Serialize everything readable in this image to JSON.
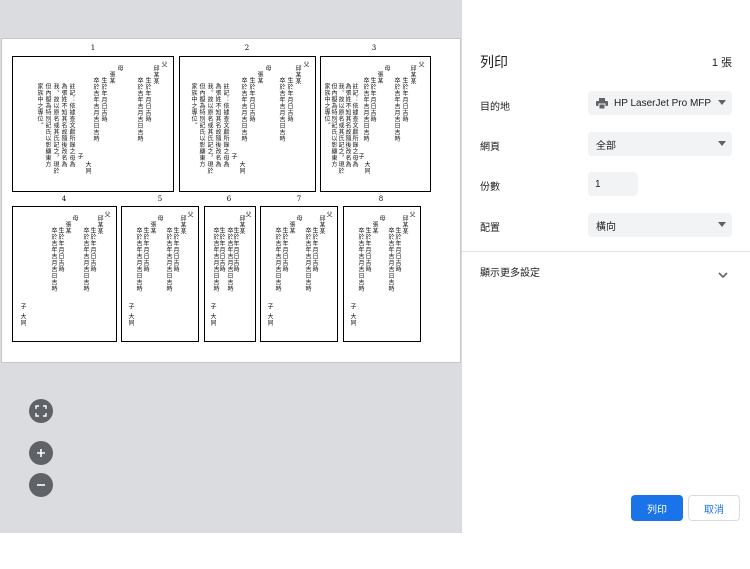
{
  "preview": {
    "page_numbers": [
      "1",
      "2",
      "3",
      "4",
      "5",
      "6",
      "7",
      "8"
    ],
    "pages_full": {
      "father": "父",
      "father_name": "邱某某",
      "mother": "母",
      "mother_name": "張某",
      "born_father": "生於年月日吉時",
      "born_mother": "生於年月日吉時",
      "died_father": "卒於吉年吉月吉日吉時",
      "died_mother": "卒於吉年吉月吉日吉時",
      "note1": "註記：依據查文獻所錄之母為",
      "note2": "張氏，姓不知其名或氏名不知其",
      "note3": "為張姓不知其名故隨後改名為",
      "note4": "我。故以原名或其氏記之，現於",
      "note5": "但內擬為特別記氏以彰顯東方",
      "note6": "家族中之專位。",
      "son": "子",
      "son_name": "大同"
    }
  },
  "controls": {
    "zoom_fit_icon": "fit-page-icon",
    "zoom_in_icon": "plus-icon",
    "zoom_out_icon": "minus-icon"
  },
  "panel": {
    "title": "列印",
    "sheet_count": "1 張",
    "destination_label": "目的地",
    "destination_value": "HP LaserJet Pro MFP",
    "pages_label": "網頁",
    "pages_value": "全部",
    "copies_label": "份數",
    "copies_value": "1",
    "layout_label": "配置",
    "layout_value": "橫向",
    "more_settings": "顯示更多設定",
    "print_button": "列印",
    "cancel_button": "取消"
  },
  "colors": {
    "primary": "#1a73e8",
    "preview_bg": "#dadce0",
    "field_bg": "#f1f3f4"
  }
}
